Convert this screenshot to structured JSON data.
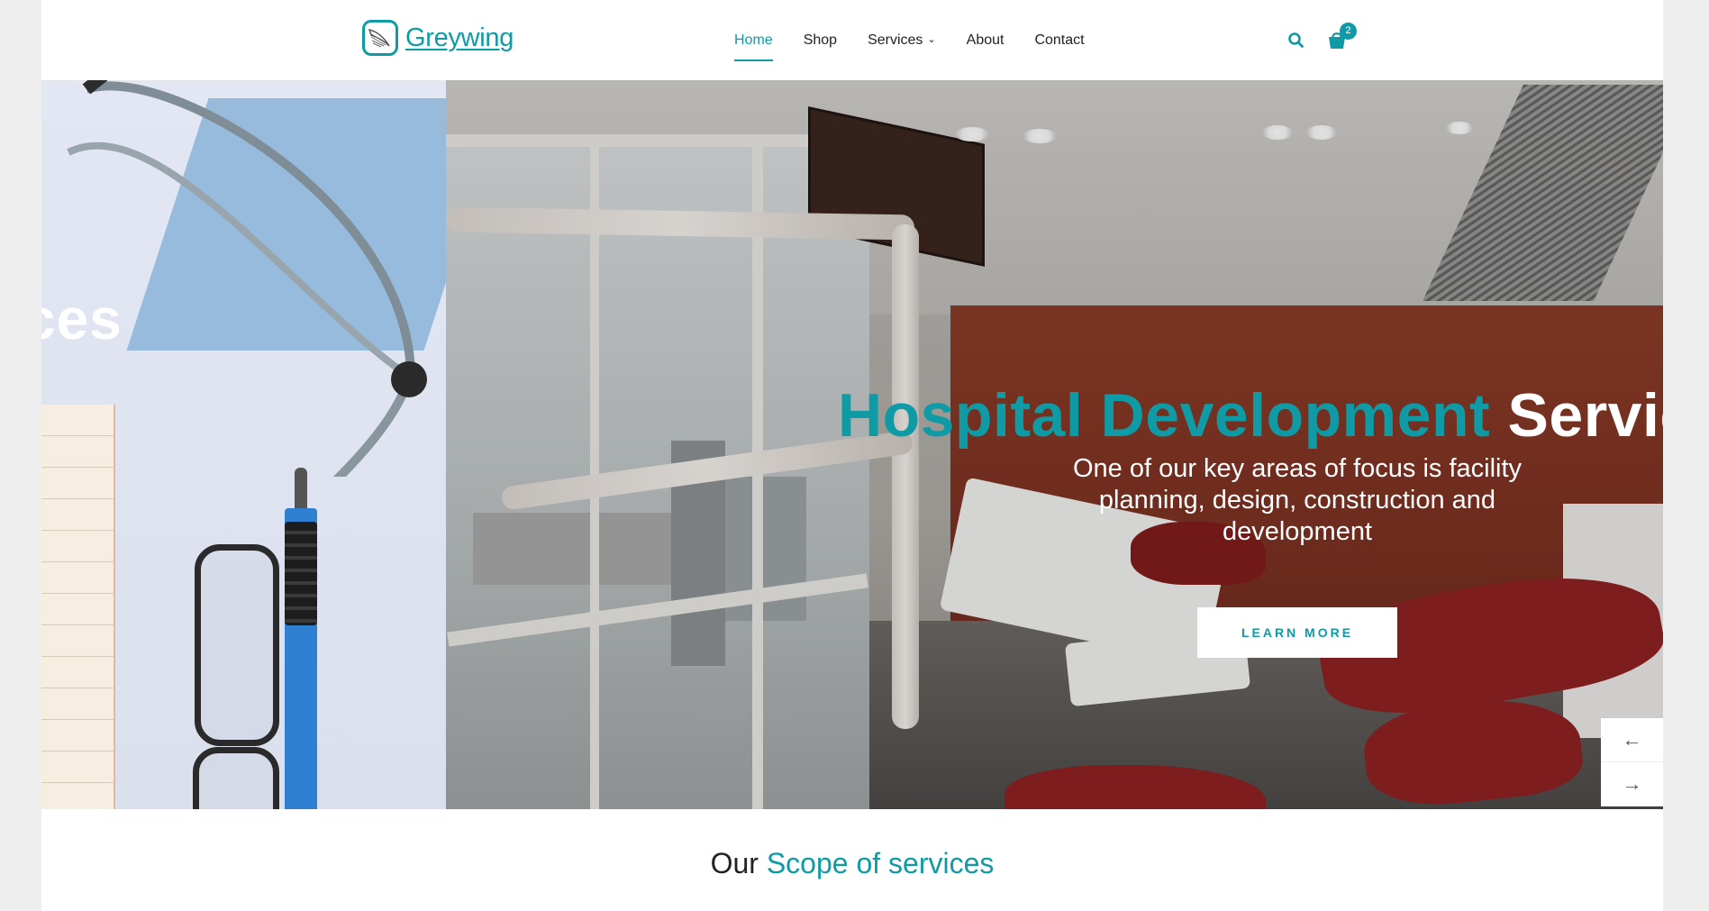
{
  "brand": {
    "name": "Greywing",
    "color": "#0e9ba6"
  },
  "nav": {
    "items": [
      {
        "label": "Home",
        "active": true
      },
      {
        "label": "Shop"
      },
      {
        "label": "Services",
        "has_dropdown": true
      },
      {
        "label": "About"
      },
      {
        "label": "Contact"
      }
    ],
    "cart_count": "2",
    "icons": {
      "search": "search-icon",
      "cart": "shopping-bag-icon",
      "dropdown": "chevron-down-icon"
    }
  },
  "hero": {
    "prev_slide_text": "ces",
    "title_accent": "Hospital Development",
    "title_rest": " Service",
    "subtitle": "One of our key areas of focus is facility planning, design, construction and development",
    "button_label": "LEARN MORE",
    "prev_arrow": "←",
    "next_arrow": "→"
  },
  "scope": {
    "title_plain": "Our ",
    "title_accent": "Scope of services"
  }
}
